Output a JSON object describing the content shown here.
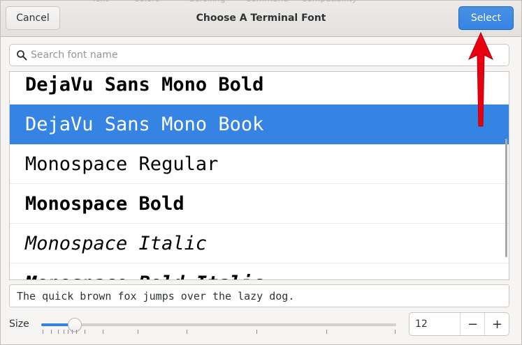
{
  "header": {
    "cancel_label": "Cancel",
    "title": "Choose A Terminal Font",
    "select_label": "Select"
  },
  "search": {
    "placeholder": "Search font name",
    "value": ""
  },
  "font_list": {
    "items": [
      {
        "label": "DejaVu Sans Mono Bold",
        "weight": "bold",
        "style": "normal",
        "selected": false
      },
      {
        "label": "DejaVu Sans Mono Book",
        "weight": "normal",
        "style": "normal",
        "selected": true
      },
      {
        "label": "Monospace Regular",
        "weight": "normal",
        "style": "normal",
        "selected": false
      },
      {
        "label": "Monospace Bold",
        "weight": "bold",
        "style": "normal",
        "selected": false
      },
      {
        "label": "Monospace Italic",
        "weight": "normal",
        "style": "italic",
        "selected": false
      },
      {
        "label": "Monospace Bold Italic",
        "weight": "bold",
        "style": "italic",
        "selected": false
      }
    ]
  },
  "preview": {
    "text": "The quick brown fox jumps over the lazy dog."
  },
  "size": {
    "label": "Size",
    "value": "12",
    "slider_fraction": 0.094,
    "decrement_label": "−",
    "increment_label": "+"
  },
  "colors": {
    "accent": "#3584e4",
    "annotation_arrow": "#e8000f"
  }
}
